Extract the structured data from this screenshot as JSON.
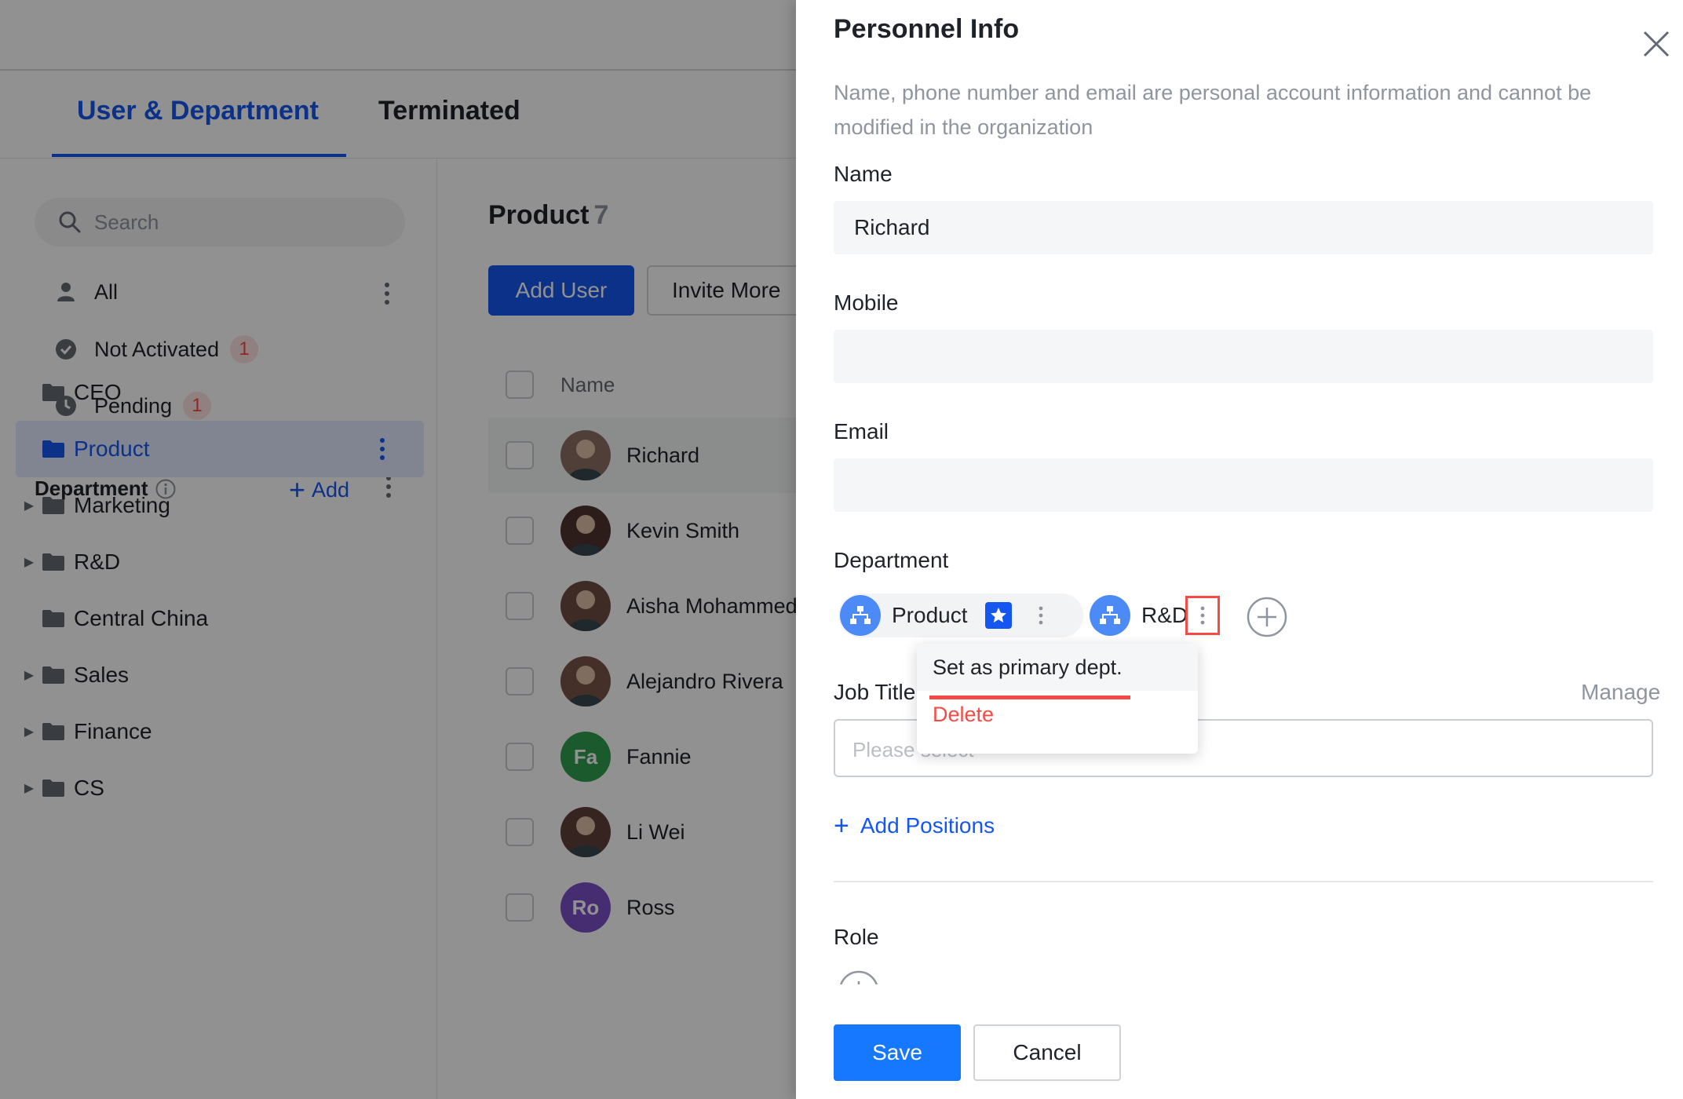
{
  "tabs": [
    {
      "label": "User & Department"
    },
    {
      "label": "Terminated"
    }
  ],
  "sidebar": {
    "search_placeholder": "Search",
    "filters": [
      {
        "label": "All",
        "icon": "person-icon"
      },
      {
        "label": "Not Activated",
        "icon": "check-circle-icon",
        "badge": "1"
      },
      {
        "label": "Pending",
        "icon": "clock-icon",
        "badge": "1"
      }
    ],
    "department_heading": "Department",
    "add_label": "Add",
    "departments": [
      {
        "label": "CEO",
        "expandable": false
      },
      {
        "label": "Product",
        "expandable": false,
        "selected": true
      },
      {
        "label": "Marketing",
        "expandable": true
      },
      {
        "label": "R&D",
        "expandable": true
      },
      {
        "label": "Central China",
        "expandable": false
      },
      {
        "label": "Sales",
        "expandable": true
      },
      {
        "label": "Finance",
        "expandable": true
      },
      {
        "label": "CS",
        "expandable": true
      }
    ]
  },
  "main": {
    "title": "Product",
    "count": "7",
    "add_user_label": "Add User",
    "invite_label": "Invite More",
    "name_column": "Name",
    "users": [
      {
        "name": "Richard",
        "initials": "",
        "color": "#8d6e63"
      },
      {
        "name": "Kevin Smith",
        "initials": "",
        "color": "#4e342e"
      },
      {
        "name": "Aisha Mohammed",
        "initials": "",
        "color": "#6d4c41"
      },
      {
        "name": "Alejandro Rivera",
        "initials": "",
        "color": "#795548"
      },
      {
        "name": "Fannie",
        "initials": "Fa",
        "color": "#2e9e4f"
      },
      {
        "name": "Li Wei",
        "initials": "",
        "color": "#5d4037"
      },
      {
        "name": "Ross",
        "initials": "Ro",
        "color": "#7b4fc9"
      }
    ]
  },
  "drawer": {
    "title": "Personnel Info",
    "description": "Name, phone number and email are personal account information and cannot be modified in the organization",
    "name_label": "Name",
    "name_value": "Richard",
    "mobile_label": "Mobile",
    "mobile_value": "",
    "email_label": "Email",
    "email_value": "",
    "department_label": "Department",
    "departments": [
      {
        "label": "Product",
        "primary": true
      },
      {
        "label": "R&D",
        "primary": false
      }
    ],
    "job_title_label": "Job Title",
    "manage_label": "Manage",
    "job_title_placeholder": "Please select",
    "add_positions_label": "Add Positions",
    "role_label": "Role",
    "save_label": "Save",
    "cancel_label": "Cancel"
  },
  "menu": {
    "items": [
      {
        "label": "Set as primary dept."
      },
      {
        "label": "Delete"
      }
    ]
  },
  "colors": {
    "accent": "#1456f0",
    "danger": "#f54a45",
    "save": "#1677ff"
  }
}
